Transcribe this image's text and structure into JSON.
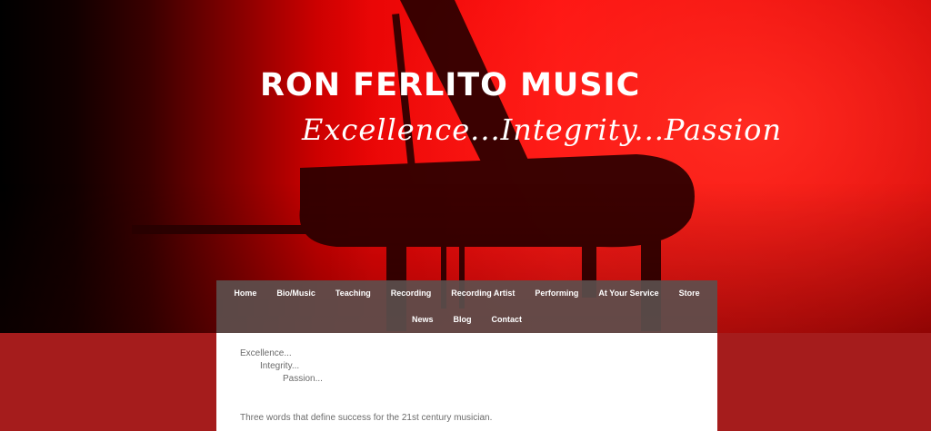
{
  "header": {
    "site_title": "RON FERLITO MUSIC",
    "tagline": "Excellence...Integrity...Passion",
    "hero_image": "grand-piano-silhouette",
    "colors": {
      "hero_red": "#ff0f0f",
      "page_red": "#a51c1c",
      "nav_bg": "#5c504e"
    }
  },
  "nav": {
    "row1": [
      "Home",
      "Bio/Music",
      "Teaching",
      "Recording",
      "Recording Artist",
      "Performing",
      "At Your Service",
      "Store"
    ],
    "row2": [
      "News",
      "Blog",
      "Contact"
    ]
  },
  "content": {
    "word1": "Excellence...",
    "word2": "Integrity...",
    "word3": "Passion...",
    "intro": "Three words that define success for the 21st century musician."
  }
}
